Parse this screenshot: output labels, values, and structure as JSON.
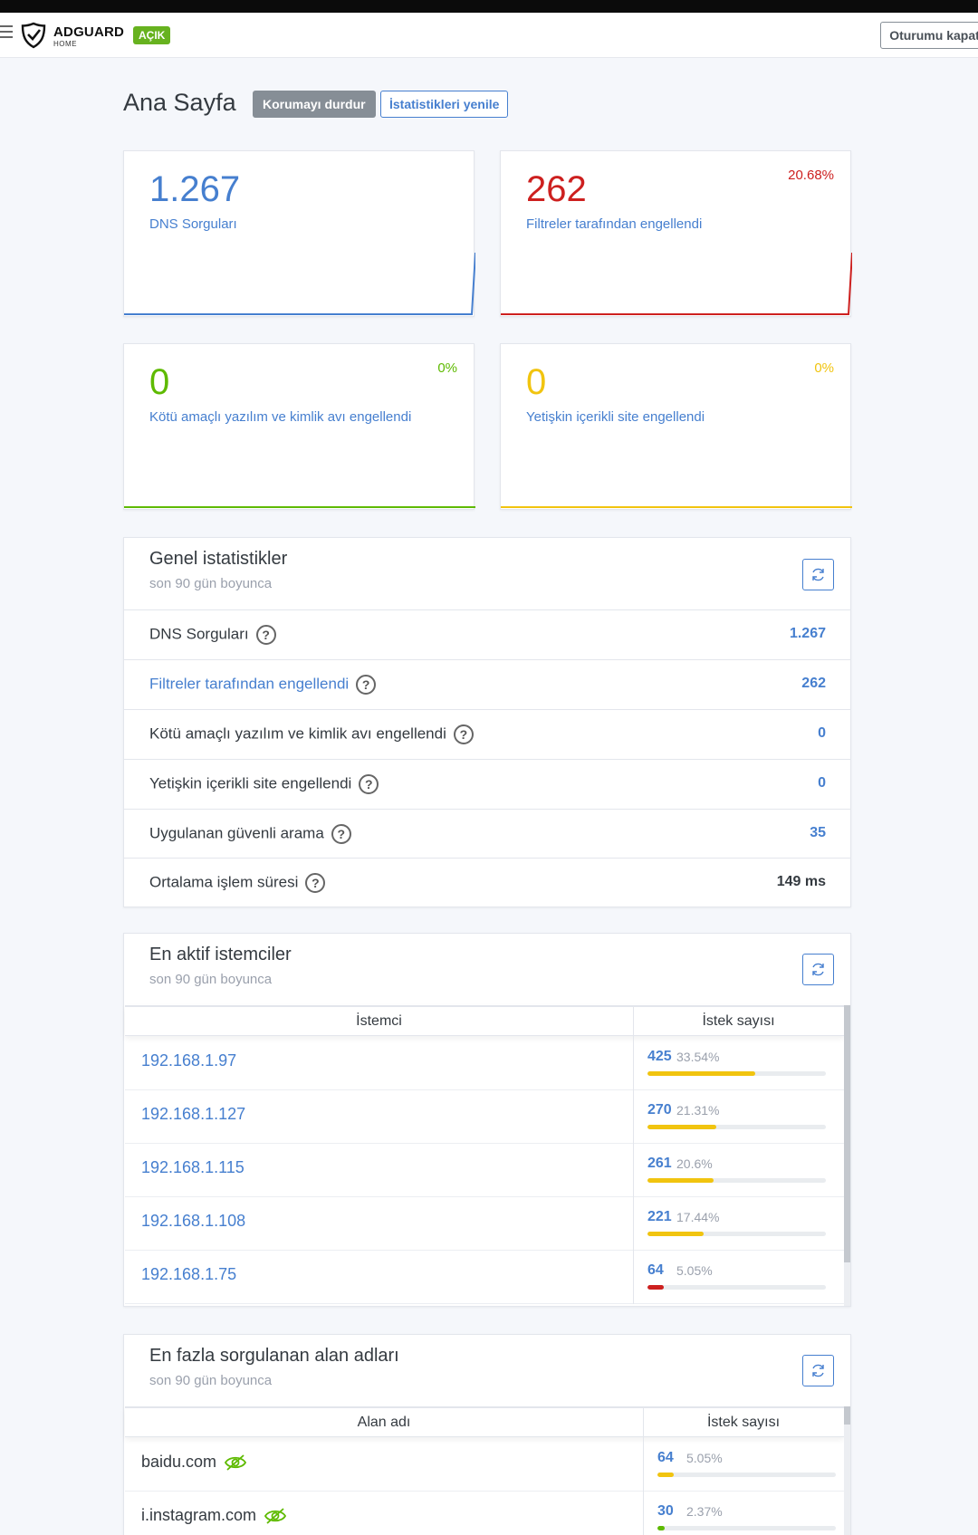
{
  "header": {
    "brand": "ADGUARD",
    "brand_sub": "HOME",
    "status": "AÇIK",
    "logout": "Oturumu kapat"
  },
  "page": {
    "title": "Ana Sayfa",
    "stop_protection": "Korumayı durdur",
    "refresh_stats": "İstatistikleri yenile"
  },
  "cards": {
    "dns": {
      "value": "1.267",
      "label": "DNS Sorguları",
      "color": "#467fcf"
    },
    "filters": {
      "value": "262",
      "label": "Filtreler tarafından engellendi",
      "percent": "20.68%",
      "color": "#cd201f"
    },
    "malware": {
      "value": "0",
      "label": "Kötü amaçlı yazılım ve kimlik avı engellendi",
      "percent": "0%",
      "color": "#5eba00"
    },
    "adult": {
      "value": "0",
      "label": "Yetişkin içerikli site engellendi",
      "percent": "0%",
      "color": "#f1c40f"
    }
  },
  "general": {
    "title": "Genel istatistikler",
    "subtitle": "son 90 gün boyunca",
    "help": "?",
    "rows": [
      {
        "label": "DNS Sorguları",
        "value": "1.267"
      },
      {
        "label": "Filtreler tarafından engellendi",
        "value": "262"
      },
      {
        "label": "Kötü amaçlı yazılım ve kimlik avı engellendi",
        "value": "0"
      },
      {
        "label": "Yetişkin içerikli site engellendi",
        "value": "0"
      },
      {
        "label": "Uygulanan güvenli arama",
        "value": "35"
      },
      {
        "label": "Ortalama işlem süresi",
        "value": "149 ms"
      }
    ]
  },
  "clients": {
    "title": "En aktif istemciler",
    "subtitle": "son 90 gün boyunca",
    "col_client": "İstemci",
    "col_count": "İstek sayısı",
    "rows": [
      {
        "name": "192.168.1.97",
        "count": "425",
        "percent": "33.54%",
        "fraction": 0.3354,
        "bar_color": "#f1c40f"
      },
      {
        "name": "192.168.1.127",
        "count": "270",
        "percent": "21.31%",
        "fraction": 0.2131,
        "bar_color": "#f1c40f"
      },
      {
        "name": "192.168.1.115",
        "count": "261",
        "percent": "20.6%",
        "fraction": 0.206,
        "bar_color": "#f1c40f"
      },
      {
        "name": "192.168.1.108",
        "count": "221",
        "percent": "17.44%",
        "fraction": 0.1744,
        "bar_color": "#f1c40f"
      },
      {
        "name": "192.168.1.75",
        "count": "64",
        "percent": "5.05%",
        "fraction": 0.0505,
        "bar_color": "#cd201f"
      }
    ]
  },
  "domains": {
    "title": "En fazla sorgulanan alan adları",
    "subtitle": "son 90 gün boyunca",
    "col_domain": "Alan adı",
    "col_count": "İstek sayısı",
    "rows": [
      {
        "name": "baidu.com",
        "count": "64",
        "percent": "5.05%",
        "fraction": 0.0505,
        "bar_color": "#f1c40f"
      },
      {
        "name": "i.instagram.com",
        "count": "30",
        "percent": "2.37%",
        "fraction": 0.0237,
        "bar_color": "#5eba00"
      }
    ]
  }
}
